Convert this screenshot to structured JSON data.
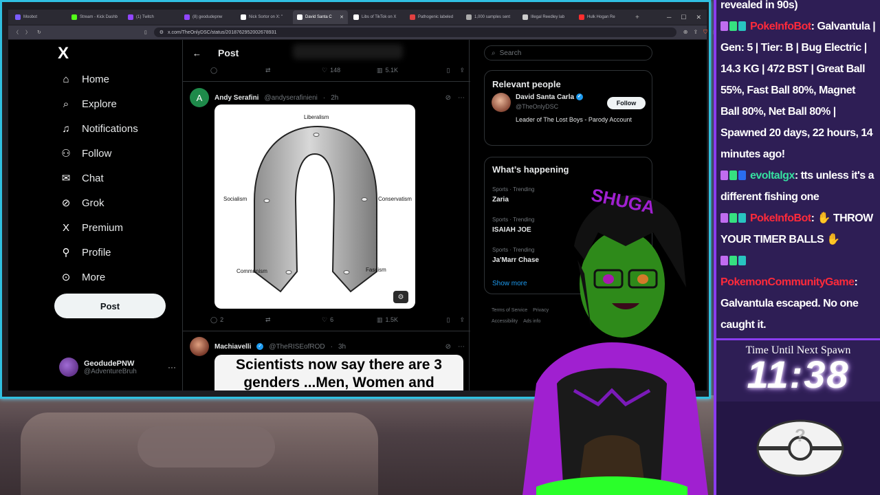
{
  "browser": {
    "tabs": [
      {
        "label": "Moobot",
        "color": "#7a5cff"
      },
      {
        "label": "Stream - Kick Dashb",
        "color": "#53fc18"
      },
      {
        "label": "(1) Twitch",
        "color": "#9146ff"
      },
      {
        "label": "(8) geodudepnw",
        "color": "#9146ff"
      },
      {
        "label": "Nick Sortor on X: \"",
        "color": "#ffffff"
      },
      {
        "label": "David Santa C",
        "color": "#ffffff",
        "active": true
      },
      {
        "label": "Libs of TikTok on X",
        "color": "#ffffff"
      },
      {
        "label": "Pathogenic labeled",
        "color": "#e04040"
      },
      {
        "label": "1,000 samples sent",
        "color": "#aaaaaa"
      },
      {
        "label": "Illegal Reedley lab",
        "color": "#cccccc"
      },
      {
        "label": "Hulk Hogan Re",
        "color": "#ff2e2e"
      }
    ],
    "new_tab": "+",
    "url": "x.com/TheOnlyDSC/status/2018762952002678931"
  },
  "nav": {
    "logo": "X",
    "items": [
      {
        "label": "Home",
        "icon": "home-icon",
        "glyph": "⌂"
      },
      {
        "label": "Explore",
        "icon": "search-icon",
        "glyph": "⌕"
      },
      {
        "label": "Notifications",
        "icon": "bell-icon",
        "glyph": "🔔︎"
      },
      {
        "label": "Follow",
        "icon": "follow-icon",
        "glyph": "⚇"
      },
      {
        "label": "Chat",
        "icon": "mail-icon",
        "glyph": "✉"
      },
      {
        "label": "Grok",
        "icon": "grok-icon",
        "glyph": "⊘"
      },
      {
        "label": "Premium",
        "icon": "premium-icon",
        "glyph": "X"
      },
      {
        "label": "Profile",
        "icon": "profile-icon",
        "glyph": "⚲"
      },
      {
        "label": "More",
        "icon": "more-icon",
        "glyph": "⋯"
      }
    ],
    "post_button": "Post",
    "account": {
      "name": "GeodudePNW",
      "handle": "@AdventureBruh",
      "more": "···"
    }
  },
  "main": {
    "header_title": "Post",
    "prev_actions": {
      "replies": "",
      "reposts": "",
      "likes": "148",
      "views": "5.1K"
    },
    "tweet1": {
      "avatar_letter": "A",
      "name": "Andy Serafini",
      "handle": "@andyserafinieni",
      "time": "2h",
      "image": {
        "labels": {
          "top": "Liberalism",
          "left": "Socialism",
          "right": "Conservatism",
          "bottom_left": "Communism",
          "bottom_right": "Fascism"
        }
      },
      "actions": {
        "replies": "2",
        "reposts": "",
        "likes": "6",
        "views": "1.5K"
      }
    },
    "tweet2": {
      "name": "Machiavelli",
      "handle": "@TheRISEofROD",
      "time": "3h",
      "image_text_line1": "Scientists now say there are 3",
      "image_text_line2": "genders ...Men, Women and"
    }
  },
  "right": {
    "search_placeholder": "Search",
    "relevant_title": "Relevant people",
    "person": {
      "name": "David Santa Carla",
      "handle": "@TheOnlyDSC",
      "bio": "Leader of The Lost Boys - Parody Account",
      "follow": "Follow"
    },
    "happening_title": "What’s happening",
    "trends": [
      {
        "category": "Sports · Trending",
        "name": "Zaria"
      },
      {
        "category": "Sports · Trending",
        "name": "ISAIAH JOE"
      },
      {
        "category": "Sports · Trending",
        "name": "Ja'Marr Chase"
      }
    ],
    "show_more": "Show more",
    "footer": [
      "Terms of Service",
      "Privacy",
      "Accessibility",
      "Ads info"
    ]
  },
  "chat": {
    "messages": [
      {
        "user": "",
        "text": "revealed in 90s)"
      },
      {
        "user": "PokeInfoBot",
        "user_color": "#ff2a3a",
        "text": ": Galvantula | Gen: 5 | Tier: B | Bug Electric | 14.3 KG | 472 BST | Great Ball 55%, Fast Ball 80%, Magnet Ball 80%, Net Ball 80% | Spawned 20 days, 22 hours, 14 minutes ago!"
      },
      {
        "user": "evoltalgx",
        "user_color": "#36e0a0",
        "text": ": tts unless it's a different fishing one"
      },
      {
        "user": "PokeInfoBot",
        "user_color": "#ff2a3a",
        "text": ": ✋ THROW YOUR TIMER BALLS ✋"
      },
      {
        "user": "PokemonCommunityGame",
        "user_color": "#ff2a3a",
        "text": ": Galvantula escaped. No one caught it."
      }
    ]
  },
  "timer": {
    "label": "Time Until Next Spawn",
    "value": "11:38"
  }
}
